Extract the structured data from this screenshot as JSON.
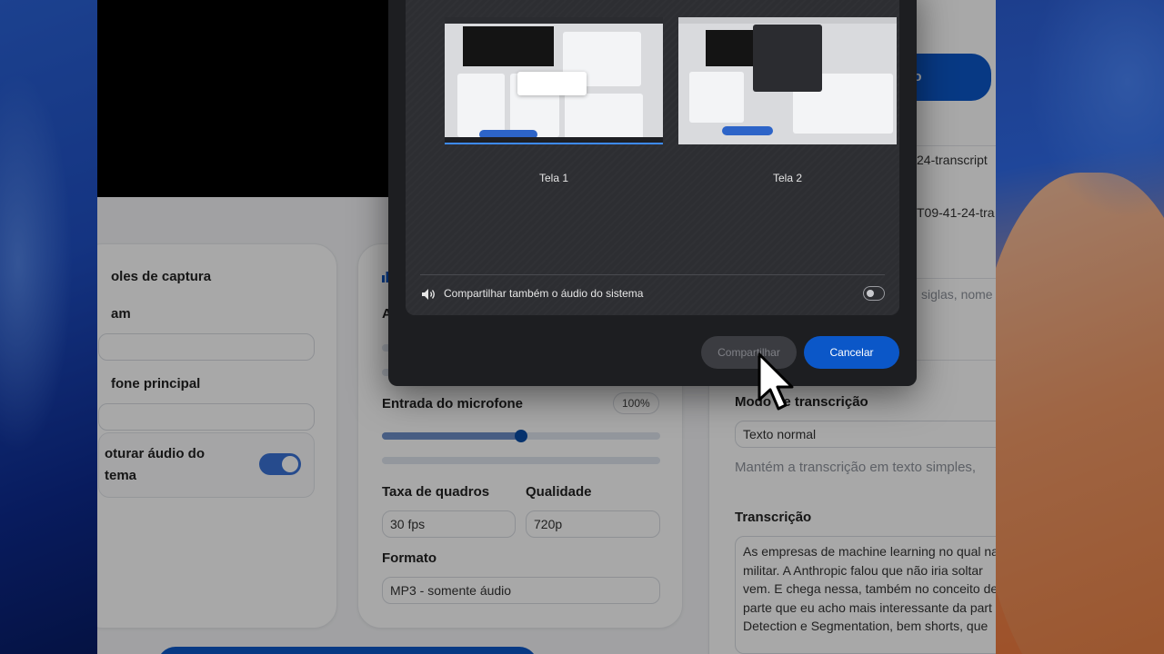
{
  "app": {
    "capture_title": "oles de captura",
    "webcam_label": "am",
    "webcam_value": "",
    "mic_label": "fone principal",
    "mic_value": "",
    "system_audio_label_1": "oturar áudio do",
    "system_audio_label_2": "tema",
    "system_audio_on": true,
    "audio_cut_label": "A",
    "mic_input_label": "Entrada do microfone",
    "mic_input_level": "100%",
    "mic_input_fraction": 0.5,
    "frame_rate_label": "Taxa de quadros",
    "frame_rate_value": "30 fps",
    "quality_label": "Qualidade",
    "quality_value": "720p",
    "format_label": "Formato",
    "format_value": "MP3 - somente áudio",
    "right_button_text": "ão",
    "file_1": "24-transcript",
    "file_2": "T09-41-24-tra",
    "glossary_hint": "siglas, nome",
    "mode_label": "Modo de transcrição",
    "mode_value": "Texto normal",
    "mode_hint": "Mantém a transcrição em texto simples,",
    "transcription_label": "Transcrição",
    "transcription_text": "As empresas de machine learning no qual na militar. A Anthropic falou que não iria soltar vem. E chega nessa, também no conceito de parte que eu acho mais interessante da part Detection e Segmentation, bem shorts, que"
  },
  "dialog": {
    "screen_1_label": "Tela 1",
    "screen_2_label": "Tela 2",
    "system_audio_label": "Compartilhar também o áudio do sistema",
    "system_audio_on": false,
    "share_button": "Compartilhar",
    "cancel_button": "Cancelar"
  },
  "colors": {
    "accent": "#0b57c8",
    "dialog_bg": "#1d1e21",
    "dialog_panel": "#2d2e32"
  },
  "icons": {
    "speaker": "speaker-icon",
    "cursor": "mouse-cursor-icon",
    "chart": "bar-chart-icon"
  }
}
